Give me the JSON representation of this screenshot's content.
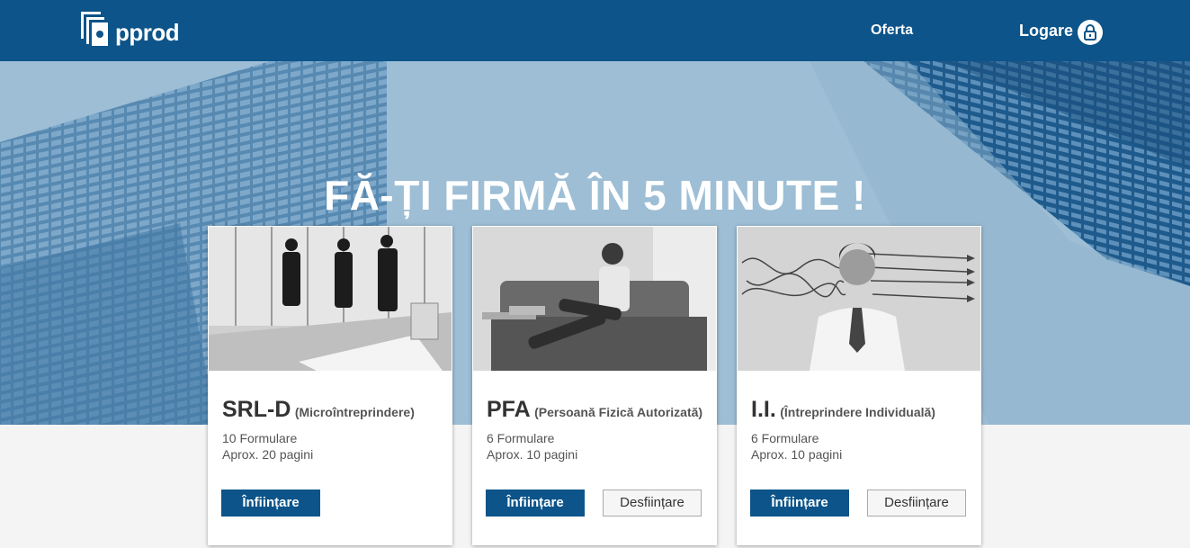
{
  "header": {
    "logo_text": "pprod",
    "nav": {
      "oferta": "Oferta",
      "logare": "Logare"
    },
    "colors": {
      "bar": "#0c5489",
      "hero": "#9dbed5"
    }
  },
  "hero": {
    "title": "FĂ-ȚI FIRMĂ ÎN 5 MINUTE !"
  },
  "cards": [
    {
      "abbr": "SRL-D",
      "full": "(Microîntreprindere)",
      "line1": "10 Formulare",
      "line2": "Aprox. 20 pagini",
      "primary": "Înființare",
      "image": "business-handshake-photo"
    },
    {
      "abbr": "PFA",
      "full": "(Persoană Fizică Autorizată)",
      "line1": "6 Formulare",
      "line2": "Aprox. 10 pagini",
      "primary": "Înființare",
      "secondary": "Desființare",
      "image": "man-with-laptop-on-sofa-photo"
    },
    {
      "abbr": "I.I.",
      "full": "(Întreprindere Individuală)",
      "line1": "6 Formulare",
      "line2": "Aprox. 10 pagini",
      "primary": "Înființare",
      "secondary": "Desființare",
      "image": "thinking-man-photo"
    }
  ]
}
